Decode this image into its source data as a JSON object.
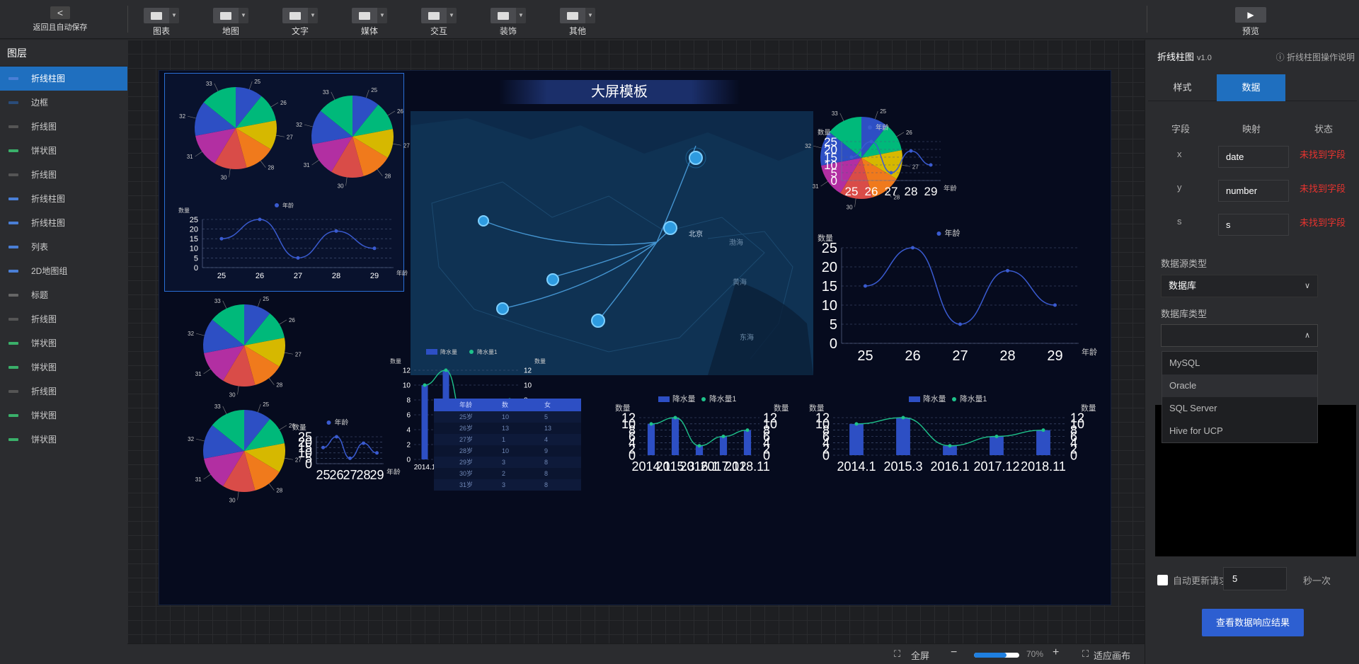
{
  "topbar": {
    "back_label": "返回且自动保存",
    "tools": [
      {
        "label": "图表",
        "icon": "chart-icon"
      },
      {
        "label": "地图",
        "icon": "map-icon"
      },
      {
        "label": "文字",
        "icon": "text-icon"
      },
      {
        "label": "媒体",
        "icon": "media-icon"
      },
      {
        "label": "交互",
        "icon": "interaction-icon"
      },
      {
        "label": "装饰",
        "icon": "decoration-icon"
      },
      {
        "label": "其他",
        "icon": "other-icon"
      }
    ],
    "preview_label": "预览"
  },
  "layers": {
    "header": "图层",
    "items": [
      {
        "label": "折线柱图",
        "active": true,
        "icon_color": "#4a7fd6"
      },
      {
        "label": "边框",
        "icon_color": "#2a4c7a"
      },
      {
        "label": "折线图",
        "icon_color": "#555"
      },
      {
        "label": "饼状图",
        "icon_color": "#3ab06a"
      },
      {
        "label": "折线图",
        "icon_color": "#555"
      },
      {
        "label": "折线柱图",
        "icon_color": "#4a7fd6"
      },
      {
        "label": "折线柱图",
        "icon_color": "#4a7fd6"
      },
      {
        "label": "列表",
        "icon_color": "#4a7fd6"
      },
      {
        "label": "2D地图组",
        "icon_color": "#4a7fd6"
      },
      {
        "label": "标题",
        "icon_color": "#666"
      },
      {
        "label": "折线图",
        "icon_color": "#555"
      },
      {
        "label": "饼状图",
        "icon_color": "#3ab06a"
      },
      {
        "label": "饼状图",
        "icon_color": "#3ab06a"
      },
      {
        "label": "折线图",
        "icon_color": "#555"
      },
      {
        "label": "饼状图",
        "icon_color": "#3ab06a"
      },
      {
        "label": "饼状图",
        "icon_color": "#3ab06a"
      }
    ]
  },
  "screen": {
    "title": "大屏模板",
    "map_labels": [
      "北京",
      "渤海",
      "黄海",
      "东海"
    ],
    "table": {
      "headers": [
        "年龄",
        "数",
        "女"
      ],
      "rows": [
        [
          "25岁",
          "10",
          "5"
        ],
        [
          "26岁",
          "13",
          "13"
        ],
        [
          "27岁",
          "1",
          "4"
        ],
        [
          "28岁",
          "10",
          "9"
        ],
        [
          "29岁",
          "3",
          "8"
        ],
        [
          "30岁",
          "2",
          "8"
        ],
        [
          "31岁",
          "3",
          "8"
        ]
      ]
    }
  },
  "chart_data": [
    {
      "type": "pie",
      "values": [
        25,
        26,
        27,
        28,
        30,
        31,
        32,
        33
      ],
      "labels": [
        "25",
        "26",
        "27",
        "28",
        "30",
        "31",
        "32",
        "33"
      ],
      "colors": [
        "#2d4fc4",
        "#00b97a",
        "#d6b800",
        "#f07a1c",
        "#d94c48",
        "#b22fa2",
        "#2d4fc4",
        "#00b97a"
      ]
    },
    {
      "type": "line",
      "title": "",
      "legend": [
        "年龄"
      ],
      "xlabel": "年龄",
      "ylabel": "数量",
      "categories": [
        "25",
        "26",
        "27",
        "28",
        "29"
      ],
      "values": [
        15,
        25,
        5,
        19,
        10
      ],
      "ylim": [
        0,
        25
      ],
      "yticks": [
        0,
        5,
        10,
        15,
        20,
        25
      ]
    },
    {
      "type": "bar",
      "legend": [
        "降水量",
        "降水量1"
      ],
      "categories": [
        "2014.1",
        "2015.3",
        "2016.1",
        "2017.12",
        "2018.11"
      ],
      "bars": [
        10,
        12,
        3,
        6,
        8
      ],
      "line": [
        10,
        12,
        3,
        6,
        8
      ],
      "ylabel": "数量",
      "y2label": "数量",
      "xlabel": "降水量",
      "ylim": [
        0,
        12
      ]
    }
  ],
  "rpanel": {
    "title": "折线柱图",
    "version": "v1.0",
    "help": "折线柱图操作说明",
    "tabs": [
      "样式",
      "数据"
    ],
    "field_headers": [
      "字段",
      "映射",
      "状态"
    ],
    "fields": [
      {
        "name": "x",
        "value": "date",
        "status": "未找到字段"
      },
      {
        "name": "y",
        "value": "number",
        "status": "未找到字段"
      },
      {
        "name": "s",
        "value": "s",
        "status": "未找到字段"
      }
    ],
    "datasource_type_label": "数据源类型",
    "datasource_type_value": "数据库",
    "db_type_label": "数据库类型",
    "db_options": [
      "MySQL",
      "Oracle",
      "SQL Server",
      "Hive for UCP"
    ],
    "auto_update_label": "自动更新请求",
    "interval_value": "5",
    "interval_unit": "秒一次",
    "view_result_btn": "查看数据响应结果"
  },
  "bottombar": {
    "fullscreen": "全屏",
    "zoom": "70%",
    "fit": "适应画布"
  }
}
